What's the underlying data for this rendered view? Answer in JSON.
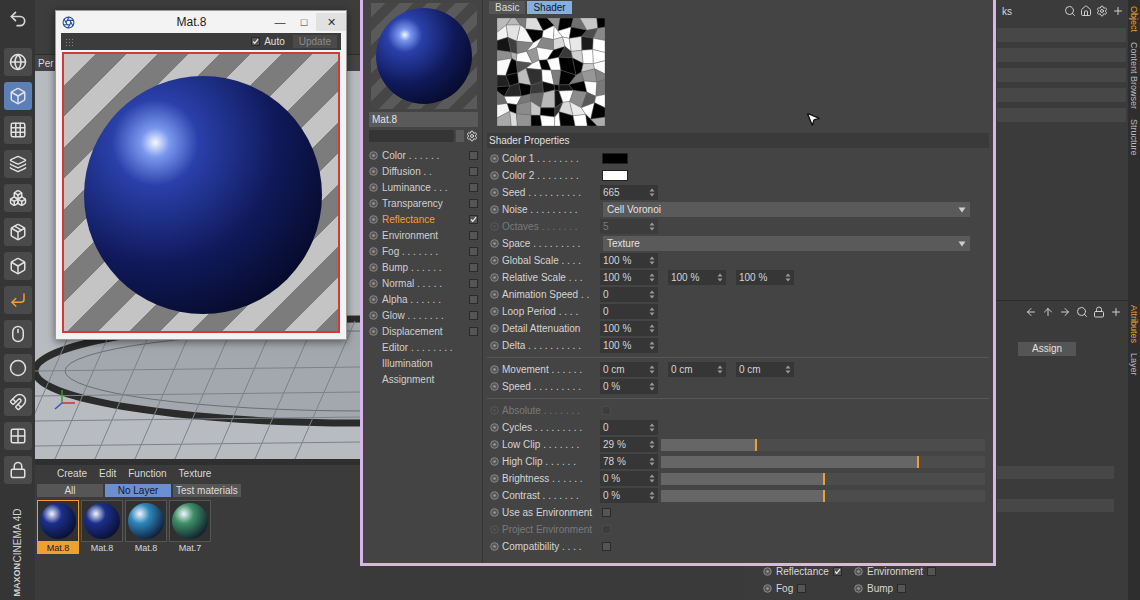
{
  "viewport": {
    "label": "Per"
  },
  "preview_window": {
    "title": "Mat.8",
    "controls": [
      "—",
      "□",
      "✕"
    ],
    "auto": {
      "label": "Auto",
      "checked": true
    },
    "update": {
      "label": "Update",
      "disabled": true
    }
  },
  "logo": {
    "brand": "MAXON",
    "product": "CINEMA 4D"
  },
  "material_manager": {
    "menu": [
      "Create",
      "Edit",
      "Function",
      "Texture"
    ],
    "tabs": [
      {
        "label": "All",
        "selected": false
      },
      {
        "label": "No Layer",
        "selected": true
      },
      {
        "label": "Test materials",
        "selected": false
      }
    ],
    "materials": [
      {
        "name": "Mat.8",
        "selected": true,
        "color": "#1c2f8a"
      },
      {
        "name": "Mat.8",
        "selected": false,
        "color": "#1c2f8a"
      },
      {
        "name": "Mat.8",
        "selected": false,
        "color": "#2f86b8"
      },
      {
        "name": "Mat.7",
        "selected": false,
        "color": "#3f8f68"
      }
    ]
  },
  "material_editor": {
    "name": "Mat.8",
    "channels": [
      {
        "label": "Color . . . . . .",
        "kind": "toggle",
        "checked": false,
        "selected": false
      },
      {
        "label": "Diffusion . .",
        "kind": "toggle",
        "checked": false,
        "selected": false
      },
      {
        "label": "Luminance . . .",
        "kind": "toggle",
        "checked": false,
        "selected": false
      },
      {
        "label": "Transparency",
        "kind": "toggle",
        "checked": false,
        "selected": false
      },
      {
        "label": "Reflectance",
        "kind": "toggle",
        "checked": true,
        "selected": true
      },
      {
        "label": "Environment",
        "kind": "toggle",
        "checked": false,
        "selected": false
      },
      {
        "label": "Fog . . . . . . .",
        "kind": "toggle",
        "checked": false,
        "selected": false
      },
      {
        "label": "Bump . . . . . .",
        "kind": "toggle",
        "checked": false,
        "selected": false
      },
      {
        "label": "Normal . . . . .",
        "kind": "toggle",
        "checked": false,
        "selected": false
      },
      {
        "label": "Alpha . . . . . .",
        "kind": "toggle",
        "checked": false,
        "selected": false
      },
      {
        "label": "Glow . . . . . . .",
        "kind": "toggle",
        "checked": false,
        "selected": false
      },
      {
        "label": "Displacement",
        "kind": "toggle",
        "checked": false,
        "selected": false
      },
      {
        "label": "Editor . . . . . . . .",
        "kind": "page",
        "checked": false,
        "selected": false
      },
      {
        "label": "Illumination",
        "kind": "page",
        "checked": false,
        "selected": false
      },
      {
        "label": "Assignment",
        "kind": "page",
        "checked": false,
        "selected": false
      }
    ],
    "tabs": [
      {
        "label": "Basic",
        "selected": false
      },
      {
        "label": "Shader",
        "selected": true
      }
    ],
    "section": "Shader Properties",
    "groups": [
      [
        {
          "label": "Color 1 . . . . . . . .",
          "kind": "color",
          "color": "#000000",
          "disabled": false
        },
        {
          "label": "Color 2 . . . . . . . .",
          "kind": "color",
          "color": "#ffffff",
          "disabled": false
        },
        {
          "label": "Seed . . . . . . . . . .",
          "kind": "number",
          "values": [
            "665"
          ],
          "disabled": false
        },
        {
          "label": "Noise . . . . . . . . .",
          "kind": "dropdown",
          "value": "Cell Voronoi",
          "disabled": false
        },
        {
          "label": "Octaves . . . . . . .",
          "kind": "number",
          "values": [
            "5"
          ],
          "disabled": true
        },
        {
          "label": "Space . . . . . . . . .",
          "kind": "dropdown",
          "value": "Texture",
          "disabled": false
        },
        {
          "label": "Global Scale . . . .",
          "kind": "number",
          "values": [
            "100 %"
          ],
          "disabled": false
        },
        {
          "label": "Relative Scale . . .",
          "kind": "number",
          "values": [
            "100 %",
            "100 %",
            "100 %"
          ],
          "disabled": false
        },
        {
          "label": "Animation Speed . .",
          "kind": "number",
          "values": [
            "0"
          ],
          "disabled": false
        },
        {
          "label": "Loop Period . . . .",
          "kind": "number",
          "values": [
            "0"
          ],
          "disabled": false
        },
        {
          "label": "Detail Attenuation",
          "kind": "number",
          "values": [
            "100 %"
          ],
          "disabled": false
        },
        {
          "label": "Delta . . . . . . . . . .",
          "kind": "number",
          "values": [
            "100 %"
          ],
          "disabled": false
        }
      ],
      [
        {
          "label": "Movement . . . . . .",
          "kind": "number",
          "values": [
            "0 cm",
            "0 cm",
            "0 cm"
          ],
          "disabled": false
        },
        {
          "label": "Speed . . . . . . . . .",
          "kind": "number",
          "values": [
            "0 %"
          ],
          "disabled": false
        }
      ],
      [
        {
          "label": "Absolute . . . . . . .",
          "kind": "checkbox",
          "checked": false,
          "disabled": true
        },
        {
          "label": "Cycles . . . . . . . . .",
          "kind": "number",
          "values": [
            "0"
          ],
          "disabled": false
        },
        {
          "label": "Low Clip . . . . . . .",
          "kind": "slider",
          "value": "29 %",
          "level": 0.29,
          "disabled": false
        },
        {
          "label": "High Clip . . . . . .",
          "kind": "slider",
          "value": "78 %",
          "level": 0.79,
          "disabled": false
        },
        {
          "label": "Brightness . . . . . .",
          "kind": "slider",
          "value": "0 %",
          "level": 0.5,
          "disabled": false
        },
        {
          "label": "Contrast . . . . . . .",
          "kind": "slider",
          "value": "0 %",
          "level": 0.5,
          "disabled": false
        },
        {
          "label": "Use as Environment",
          "kind": "checkbox",
          "checked": false,
          "disabled": false
        },
        {
          "label": "Project Environment",
          "kind": "checkbox",
          "checked": false,
          "disabled": true
        },
        {
          "label": "Compatibility . . . .",
          "kind": "checkbox",
          "checked": false,
          "disabled": false
        }
      ]
    ]
  },
  "right_panel": {
    "header": "ks",
    "assign": "Assign",
    "toggles": [
      {
        "label": "Reflectance",
        "checked": true
      },
      {
        "label": "Environment",
        "checked": false
      },
      {
        "label": "Fog",
        "checked": false
      },
      {
        "label": "Bump",
        "checked": false
      }
    ],
    "top_tabs": [
      {
        "label": "Object",
        "selected": true
      },
      {
        "label": "Content Browser",
        "selected": false
      },
      {
        "label": "Structure",
        "selected": false
      }
    ],
    "bottom_tabs": [
      {
        "label": "Attributes",
        "selected": true
      },
      {
        "label": "Layer",
        "selected": false
      }
    ]
  }
}
